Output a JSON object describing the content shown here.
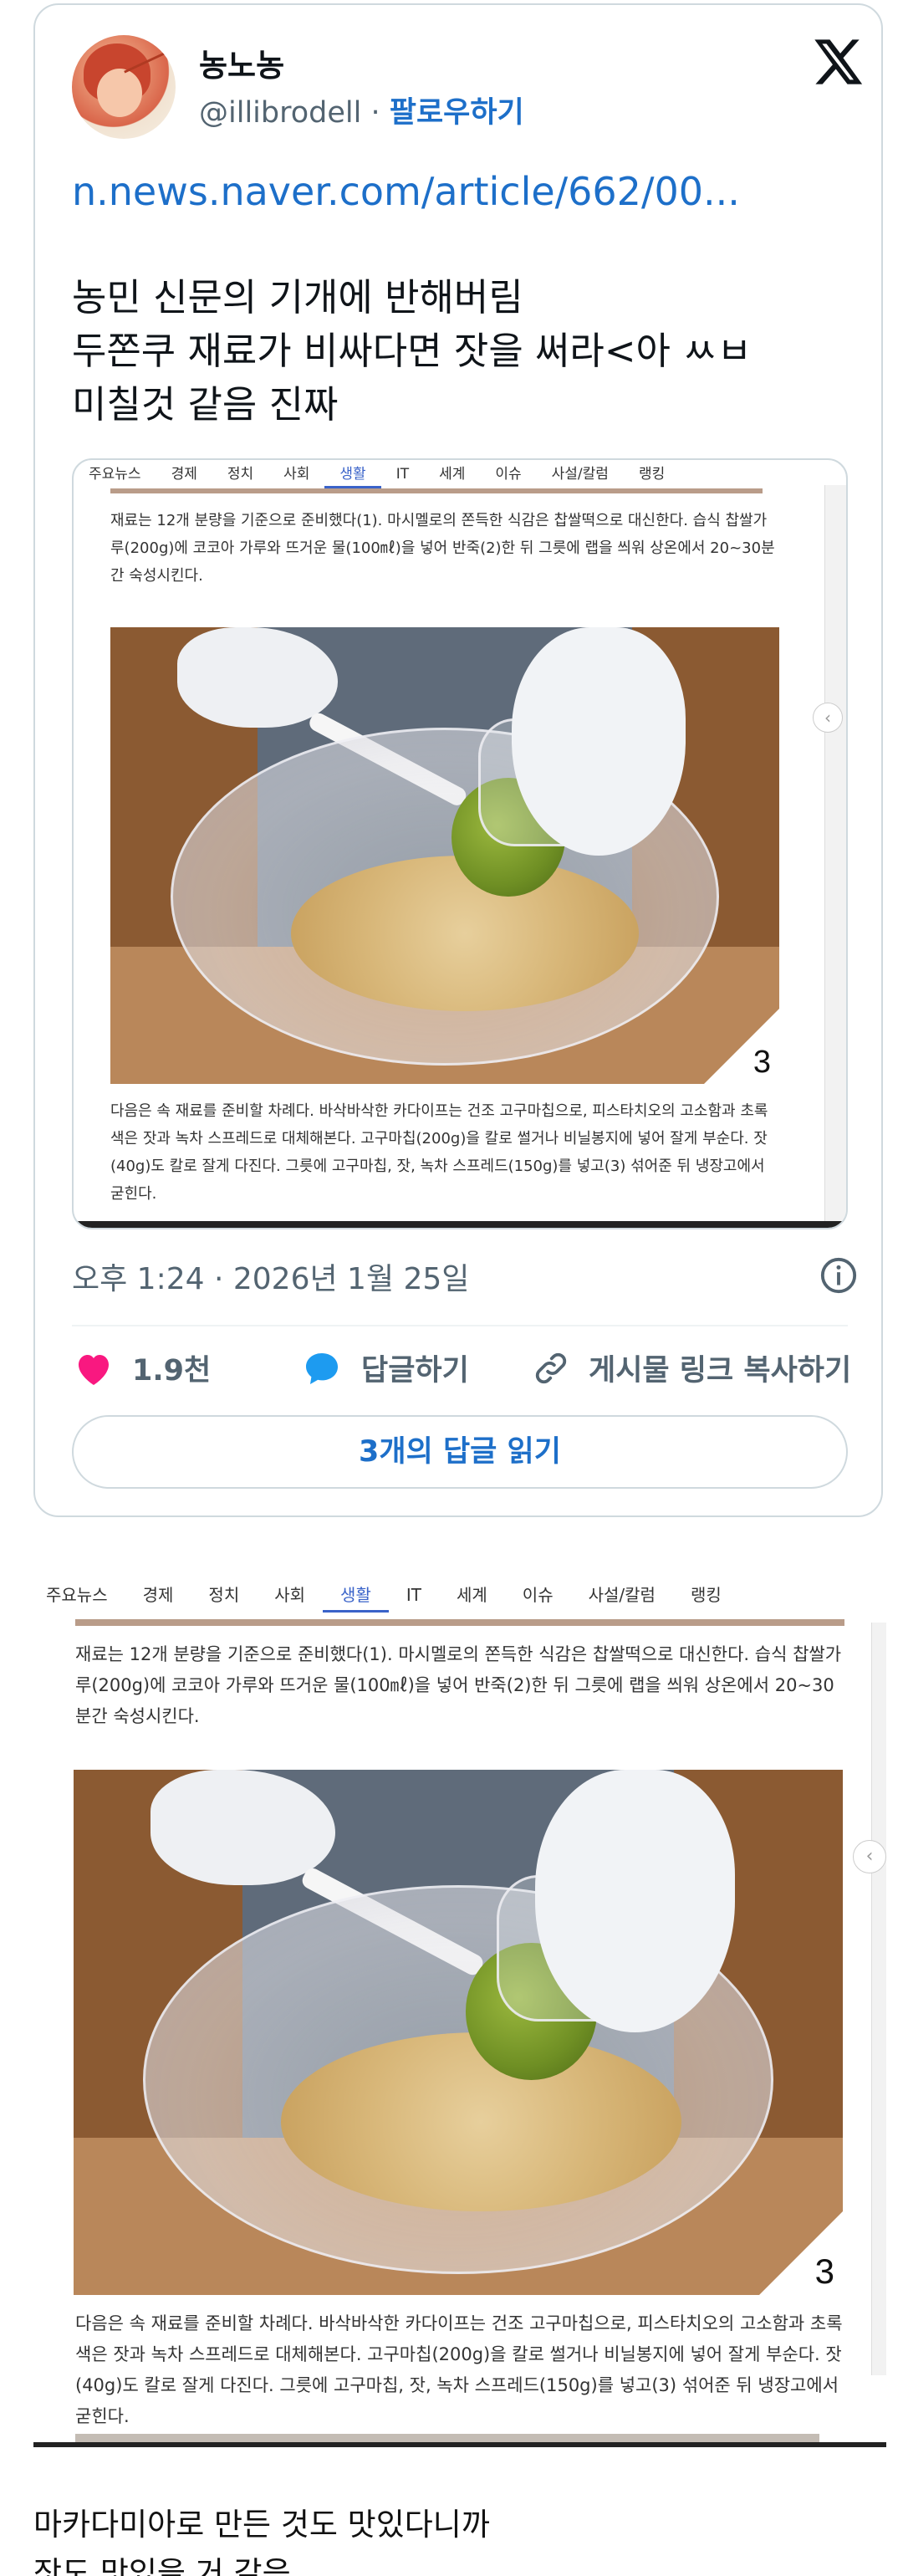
{
  "tweet": {
    "display_name": "농노농",
    "handle": "@illibrodell",
    "separator": " · ",
    "follow_label": "팔로우하기",
    "link_text": "n.news.naver.com/article/662/00...",
    "text_lines": [
      "농민 신문의 기개에 반해버림",
      "두쫀쿠 재료가 비싸다면 잣을 써라<아 ㅆㅂ",
      "미칠것 같음 진짜"
    ],
    "timestamp": "오후 1:24 · 2026년 1월 25일",
    "likes_count": "1.9천",
    "reply_label": "답글하기",
    "copy_link_label": "게시물 링크 복사하기",
    "read_replies_label": "3개의 답글 읽기",
    "colors": {
      "like": "#f91880",
      "link": "#1d6fc9",
      "reply": "#1d9bf0",
      "muted": "#536471"
    }
  },
  "news": {
    "tabs": [
      "주요뉴스",
      "경제",
      "정치",
      "사회",
      "생활",
      "IT",
      "세계",
      "이슈",
      "사설/칼럼",
      "랭킹"
    ],
    "active_tab": "생활",
    "paragraph1": "재료는 12개 분량을 기준으로 준비했다(1). 마시멜로의 쫀득한 식감은 찹쌀떡으로 대신한다. 습식 찹쌀가루(200g)에 코코아 가루와 뜨거운 물(100㎖)을 넣어 반죽(2)한 뒤 그릇에 랩을 씌워 상온에서 20~30분간 숙성시킨다.",
    "photo_number": "3",
    "paragraph2": "다음은 속 재료를 준비할 차례다. 바삭바삭한 카다이프는 건조 고구마칩으로, 피스타치오의 고소함과 초록색은 잣과 녹차 스프레드로 대체해본다. 고구마칩(200g)을 칼로 썰거나 비닐봉지에 넣어 잘게 부순다. 잣(40g)도 칼로 잘게 다진다. 그릇에 고구마칩, 잣, 녹차 스프레드(150g)를 넣고(3) 섞어준 뒤 냉장고에서 굳힌다."
  },
  "caption": {
    "line1": "마카다미아로 만든 것도 맛있다니까",
    "line2": "잣도 맛있을 거 같음"
  },
  "icons": {
    "x_logo": "x-logo-icon",
    "info": "info-icon",
    "like": "heart-icon",
    "reply": "speech-bubble-icon",
    "copy_link": "link-icon"
  }
}
